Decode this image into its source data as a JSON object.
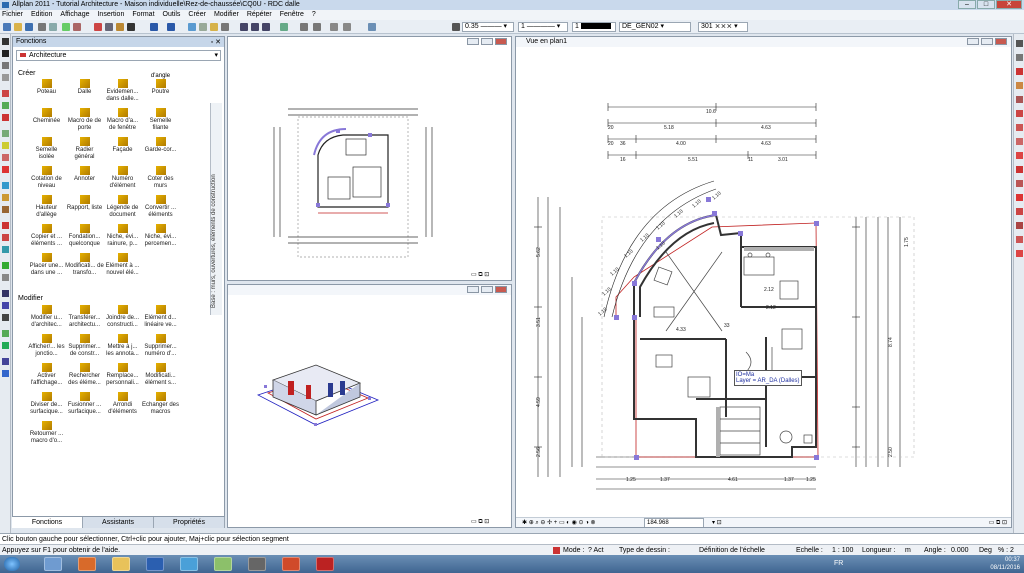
{
  "window": {
    "title": "Allplan 2011 - Tutorial Architecture - Maison individuelle\\Rez-de-chaussée\\CQ0U - RDC dalle"
  },
  "menu": [
    "Fichier",
    "Edition",
    "Affichage",
    "Insertion",
    "Format",
    "Outils",
    "Créer",
    "Modifier",
    "Répéter",
    "Fenêtre",
    "?"
  ],
  "toolbar": {
    "pen": "0.35",
    "line": "1",
    "color": "1",
    "layer": "DE_GEN02",
    "hatch": "301"
  },
  "panel": {
    "title": "Fonctions",
    "module": "Architecture",
    "section_create": "Créer",
    "section_modify": "Modifier",
    "side_tab": "Base : murs, ouvertures, éléments de construction",
    "create_items": [
      "Poteau",
      "Dalle",
      "Evidemen... dans dalle...",
      "Poutre",
      "Cheminée",
      "Macro de de porte",
      "Macro d'a... de fenêtre",
      "Semelle filante",
      "Semelle isolée",
      "Radier général",
      "Façade",
      "Garde-cor...",
      "Cotation de niveau",
      "Annoter",
      "Numéro d'élément",
      "Coter des murs",
      "Hauteur d'allège",
      "Rapport, liste",
      "Légende de document",
      "Convertir ... éléments",
      "Copier et ... éléments ...",
      "Fondation... quelconque",
      "Niche, évi... rainure, p...",
      "Niche, évi... percemen...",
      "Placer une... dans une ...",
      "Modificati... de transfo...",
      "Elément à ... nouvel élé..."
    ],
    "create_header_note": "d'angle",
    "modify_items": [
      "Modifier u... d'architec...",
      "Transférer... architectu...",
      "Joindre de... constructi...",
      "Elément d... linéaire ve...",
      "Afficher/... les jonctio...",
      "Supprimer... de constr...",
      "Mettre à j... les annota...",
      "Supprimer... numéro d'...",
      "Activer l'affichage...",
      "Rechercher des éléme...",
      "Remplace... personnali...",
      "Modificati... élément s...",
      "Diviser de... surfacique...",
      "Fusionner ... surfacique...",
      "Arrondi d'éléments",
      "Echanger des macros",
      "Retourner ... macro d'o..."
    ],
    "tabs": [
      "Fonctions",
      "Assistants",
      "Propriétés"
    ]
  },
  "viewport_main": {
    "title": "Vue en plan1",
    "scale_value": "184.968"
  },
  "plan_dims": [
    "10.6",
    "5.18",
    "4.63",
    "20",
    "20",
    "36",
    "4.00",
    "4.63",
    "16",
    "5.51",
    "11",
    "3.01",
    "1.10",
    "1.10",
    "1.10",
    "1.10",
    "1.10",
    "1.10",
    "1.10",
    "1.10",
    "1.10",
    "1.10",
    "4.33",
    "33",
    "1.25",
    "1.37",
    "4.61",
    "1.37",
    "1.25",
    "5.62",
    "3.51",
    "4.59",
    "2.56",
    "1.75",
    "8.74",
    "2.50",
    "2.12",
    "2.12"
  ],
  "plan_tag": {
    "line1": "IO=Ma",
    "line2": "Layer = AR_DA (Dalles)"
  },
  "hint": "Clic bouton gauche pour sélectionner, Ctrl+clic pour ajouter, Maj+clic pour sélection segment",
  "status": {
    "help": "Appuyez sur F1 pour obtenir de l'aide.",
    "mode_label": "Mode :",
    "mode_value": "? Act",
    "drawing_type_label": "Type de dessin :",
    "drawing_type_value": "Définition de l'échelle",
    "scale_label": "Echelle :",
    "scale_value": "1 : 100",
    "length_label": "Longueur :",
    "length_value": "m",
    "angle_label": "Angle :",
    "angle_value": "0.000",
    "deg": "Deg",
    "pct": "% : 2"
  },
  "tray": {
    "lang": "FR",
    "time": "00:37",
    "date": "08/11/2016"
  },
  "colors": {
    "titlebar": "#c9d9ec",
    "wall": "#555555",
    "selection": "#8878d8",
    "dims": "#222222",
    "redline": "#c02020"
  }
}
